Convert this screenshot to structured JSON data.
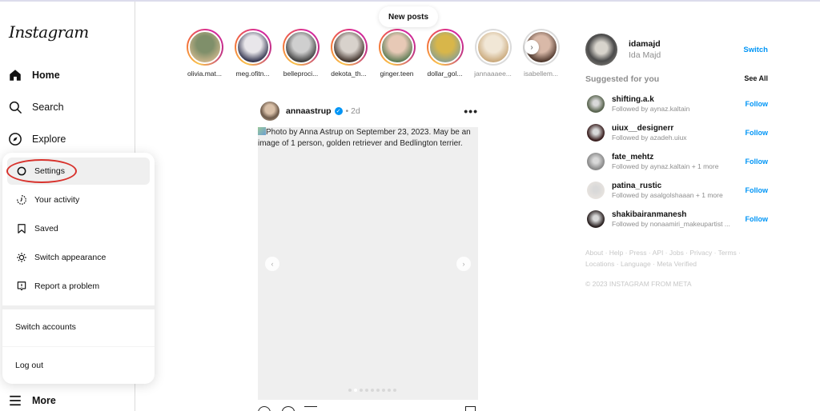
{
  "app": {
    "logo": "Instagram"
  },
  "sidebar": {
    "items": [
      {
        "label": "Home",
        "icon": "home-icon"
      },
      {
        "label": "Search",
        "icon": "search-icon"
      },
      {
        "label": "Explore",
        "icon": "explore-icon"
      }
    ],
    "more": {
      "label": "More",
      "icon": "menu-icon"
    }
  },
  "more_menu": {
    "items": [
      {
        "label": "Settings",
        "icon": "settings-icon",
        "active": true
      },
      {
        "label": "Your activity",
        "icon": "activity-icon"
      },
      {
        "label": "Saved",
        "icon": "bookmark-icon"
      },
      {
        "label": "Switch appearance",
        "icon": "sun-icon"
      },
      {
        "label": "Report a problem",
        "icon": "report-icon"
      }
    ],
    "switch_accounts": "Switch accounts",
    "log_out": "Log out"
  },
  "feed": {
    "new_posts": "New posts",
    "stories": [
      {
        "name": "olivia.mat...",
        "seen": false,
        "colors": [
          "#7f8f6a",
          "#c9b48a"
        ]
      },
      {
        "name": "meg.ofitn...",
        "seen": false,
        "colors": [
          "#e8e6ea",
          "#2d2f4a"
        ]
      },
      {
        "name": "belleproci...",
        "seen": false,
        "colors": [
          "#cfcfcf",
          "#3a3a3a"
        ]
      },
      {
        "name": "dekota_th...",
        "seen": false,
        "colors": [
          "#d8d2cc",
          "#3b2d26"
        ]
      },
      {
        "name": "ginger.teen",
        "seen": false,
        "colors": [
          "#e7c9b6",
          "#5a7a52"
        ]
      },
      {
        "name": "dollar_gol...",
        "seen": false,
        "colors": [
          "#d8b64a",
          "#8fa18c"
        ]
      },
      {
        "name": "jannaaaee...",
        "seen": true,
        "colors": [
          "#f1e7d6",
          "#c9a87a"
        ]
      },
      {
        "name": "isabellem...",
        "seen": true,
        "colors": [
          "#d9b9a8",
          "#4a3328"
        ]
      }
    ],
    "post": {
      "username": "annaastrup",
      "verified": true,
      "separator": "•",
      "time": "2d",
      "more": "•••",
      "alt_text": "Photo by Anna Astrup on September 23, 2023. May be an image of 1 person, golden retriever and Bedlington terrier.",
      "carousel": {
        "total": 9,
        "active_index": 1
      }
    }
  },
  "right_panel": {
    "me": {
      "username": "idamajd",
      "name": "Ida Majd",
      "switch_label": "Switch"
    },
    "suggested_title": "Suggested for you",
    "see_all": "See All",
    "suggestions": [
      {
        "username": "shifting.a.k",
        "followed_by": "Followed by aynaz.kaltain",
        "follow": "Follow",
        "color": "#5a6550"
      },
      {
        "username": "uiux__designerr",
        "followed_by": "Followed by azadeh.uiux",
        "follow": "Follow",
        "color": "#3a2020"
      },
      {
        "username": "fate_mehtz",
        "followed_by": "Followed by aynaz.kaltain + 1 more",
        "follow": "Follow",
        "color": "#8a8a8a"
      },
      {
        "username": "patina_rustic",
        "followed_by": "Followed by asalgolshaaan + 1 more",
        "follow": "Follow",
        "color": "#e6e2de"
      },
      {
        "username": "shakibairanmanesh",
        "followed_by": "Followed by nonaamiri_makeupartist ...",
        "follow": "Follow",
        "color": "#2b2222"
      }
    ],
    "footer_links": "About · Help · Press · API · Jobs · Privacy · Terms · Locations · Language · Meta Verified",
    "copyright": "© 2023 INSTAGRAM FROM META"
  }
}
